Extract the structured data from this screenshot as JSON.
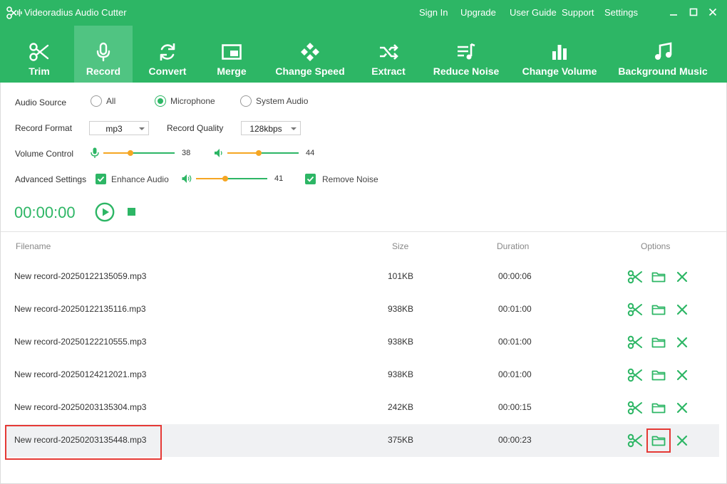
{
  "titlebar": {
    "title": "Videoradius Audio Cutter",
    "menu": [
      "Sign In",
      "Upgrade",
      "User Guide",
      "Support",
      "Settings"
    ]
  },
  "toolbar": {
    "items": [
      {
        "label": "Trim",
        "icon": "scissors-icon"
      },
      {
        "label": "Record",
        "icon": "microphone-icon",
        "active": true
      },
      {
        "label": "Convert",
        "icon": "convert-icon"
      },
      {
        "label": "Merge",
        "icon": "merge-icon"
      },
      {
        "label": "Change Speed",
        "icon": "gamepad-icon"
      },
      {
        "label": "Extract",
        "icon": "shuffle-icon"
      },
      {
        "label": "Reduce Noise",
        "icon": "reduce-noise-icon"
      },
      {
        "label": "Change Volume",
        "icon": "bar-chart-icon"
      },
      {
        "label": "Background Music",
        "icon": "music-note-icon"
      }
    ]
  },
  "settings": {
    "audio_source": {
      "label": "Audio Source",
      "options": [
        "All",
        "Microphone",
        "System Audio"
      ],
      "selected": "Microphone"
    },
    "record_format": {
      "label": "Record Format",
      "value": "mp3"
    },
    "record_quality": {
      "label": "Record Quality",
      "value": "128kbps"
    },
    "volume_control": {
      "label": "Volume Control",
      "mic_volume": 38,
      "system_volume": 44
    },
    "advanced": {
      "label": "Advanced Settings",
      "enhance_audio": {
        "label": "Enhance Audio",
        "checked": true,
        "value": 41
      },
      "remove_noise": {
        "label": "Remove Noise",
        "checked": true
      }
    }
  },
  "recorder": {
    "timer": "00:00:00"
  },
  "file_list": {
    "columns": {
      "filename": "Filename",
      "size": "Size",
      "duration": "Duration",
      "options": "Options"
    },
    "rows": [
      {
        "filename": "New record-20250122135059.mp3",
        "size": "101KB",
        "duration": "00:00:06"
      },
      {
        "filename": "New record-20250122135116.mp3",
        "size": "938KB",
        "duration": "00:01:00"
      },
      {
        "filename": "New record-20250122210555.mp3",
        "size": "938KB",
        "duration": "00:01:00"
      },
      {
        "filename": "New record-20250124212021.mp3",
        "size": "938KB",
        "duration": "00:01:00"
      },
      {
        "filename": "New record-20250203135304.mp3",
        "size": "242KB",
        "duration": "00:00:15"
      },
      {
        "filename": "New record-20250203135448.mp3",
        "size": "375KB",
        "duration": "00:00:23",
        "selected": true
      }
    ]
  },
  "colors": {
    "brand": "#2db665",
    "active_tab": "#50c482",
    "slider": "#f5a623",
    "highlight": "#e53935"
  }
}
